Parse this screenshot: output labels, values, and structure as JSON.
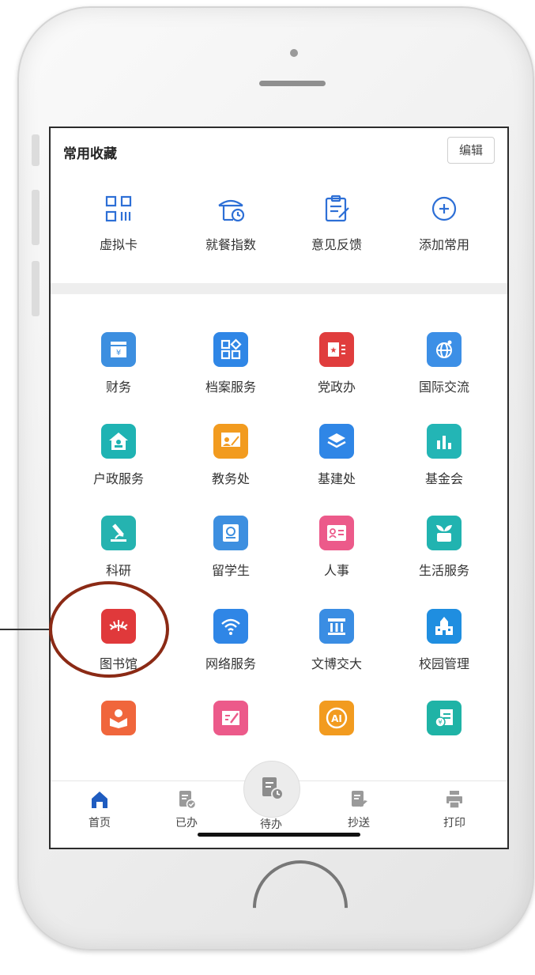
{
  "favorites": {
    "title": "常用收藏",
    "edit_label": "编辑",
    "items": [
      {
        "label": "虚拟卡",
        "icon": "qr-card-icon"
      },
      {
        "label": "就餐指数",
        "icon": "dining-index-icon"
      },
      {
        "label": "意见反馈",
        "icon": "feedback-icon"
      },
      {
        "label": "添加常用",
        "icon": "add-circle-icon"
      }
    ]
  },
  "apps": [
    {
      "label": "财务",
      "icon": "finance-icon",
      "color": "#3d8fe0"
    },
    {
      "label": "档案服务",
      "icon": "archive-icon",
      "color": "#2f86e6"
    },
    {
      "label": "党政办",
      "icon": "party-office-icon",
      "color": "#e03d3d"
    },
    {
      "label": "国际交流",
      "icon": "globe-icon",
      "color": "#3c8fe6"
    },
    {
      "label": "户政服务",
      "icon": "household-icon",
      "color": "#1fb3b3"
    },
    {
      "label": "教务处",
      "icon": "teaching-icon",
      "color": "#f29b1f"
    },
    {
      "label": "基建处",
      "icon": "layers-icon",
      "color": "#2f86e6"
    },
    {
      "label": "基金会",
      "icon": "bar-chart-icon",
      "color": "#23b5b5"
    },
    {
      "label": "科研",
      "icon": "microscope-icon",
      "color": "#25b3b0"
    },
    {
      "label": "留学生",
      "icon": "student-book-icon",
      "color": "#3d8fe0"
    },
    {
      "label": "人事",
      "icon": "id-card-icon",
      "color": "#ec5a8a"
    },
    {
      "label": "生活服务",
      "icon": "plant-icon",
      "color": "#21b3b0"
    },
    {
      "label": "图书馆",
      "icon": "library-icon",
      "color": "#e0393b"
    },
    {
      "label": "网络服务",
      "icon": "wifi-icon",
      "color": "#2f86e6"
    },
    {
      "label": "文博交大",
      "icon": "museum-icon",
      "color": "#3a8de3"
    },
    {
      "label": "校园管理",
      "icon": "campus-icon",
      "color": "#1f8ee0"
    },
    {
      "label": "",
      "icon": "reading-icon",
      "color": "#f0663c"
    },
    {
      "label": "",
      "icon": "note-edit-icon",
      "color": "#ec5a8a"
    },
    {
      "label": "",
      "icon": "ai-icon",
      "color": "#f29b1f"
    },
    {
      "label": "",
      "icon": "bill-icon",
      "color": "#1fb3a6"
    }
  ],
  "tabbar": {
    "items": [
      {
        "label": "首页",
        "icon": "home-icon"
      },
      {
        "label": "已办",
        "icon": "done-doc-icon"
      },
      {
        "label": "待办",
        "icon": "todo-doc-icon"
      },
      {
        "label": "抄送",
        "icon": "cc-doc-icon"
      },
      {
        "label": "打印",
        "icon": "print-icon"
      }
    ]
  }
}
